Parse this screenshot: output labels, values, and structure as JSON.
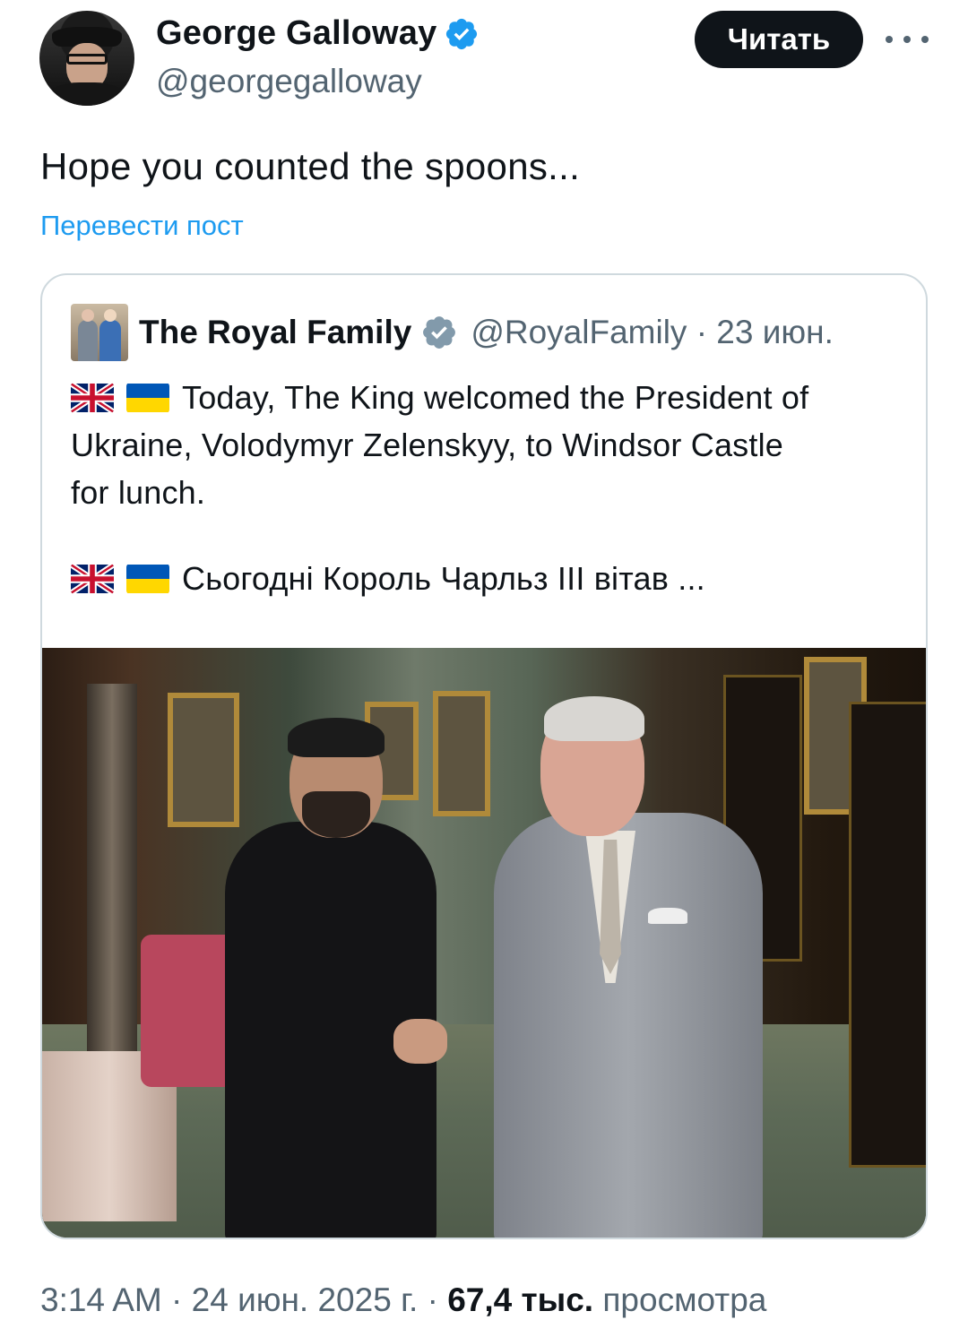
{
  "author": {
    "name": "George Galloway",
    "handle": "@georgegalloway",
    "verified": true
  },
  "actions": {
    "follow_label": "Читать",
    "more_icon": "more-horizontal-icon"
  },
  "post": {
    "text": "Hope you counted the spoons...",
    "translate_label": "Перевести пост"
  },
  "quoted": {
    "name": "The Royal Family",
    "handle_date": "@RoyalFamily · 23 июн.",
    "badge": "government-verified-badge",
    "line1": "Today, The King welcomed the President of",
    "line2": "Ukraine, Volodymyr Zelenskyy, to Windsor Castle",
    "line3": "for lunch.",
    "line4": "Сьогодні Король Чарльз III вітав ...",
    "flags": [
      "uk-flag",
      "ukraine-flag"
    ],
    "image_alt": "photo-handshake-windsor-castle"
  },
  "footer": {
    "time_date": "3:14 AM · 24 июн. 2025 г. · ",
    "views_count": "67,4 тыс.",
    "views_label": " просмотра"
  },
  "colors": {
    "accent": "#1d9bf0",
    "text": "#0f1419",
    "secondary": "#536471",
    "border": "#cfd9de"
  }
}
